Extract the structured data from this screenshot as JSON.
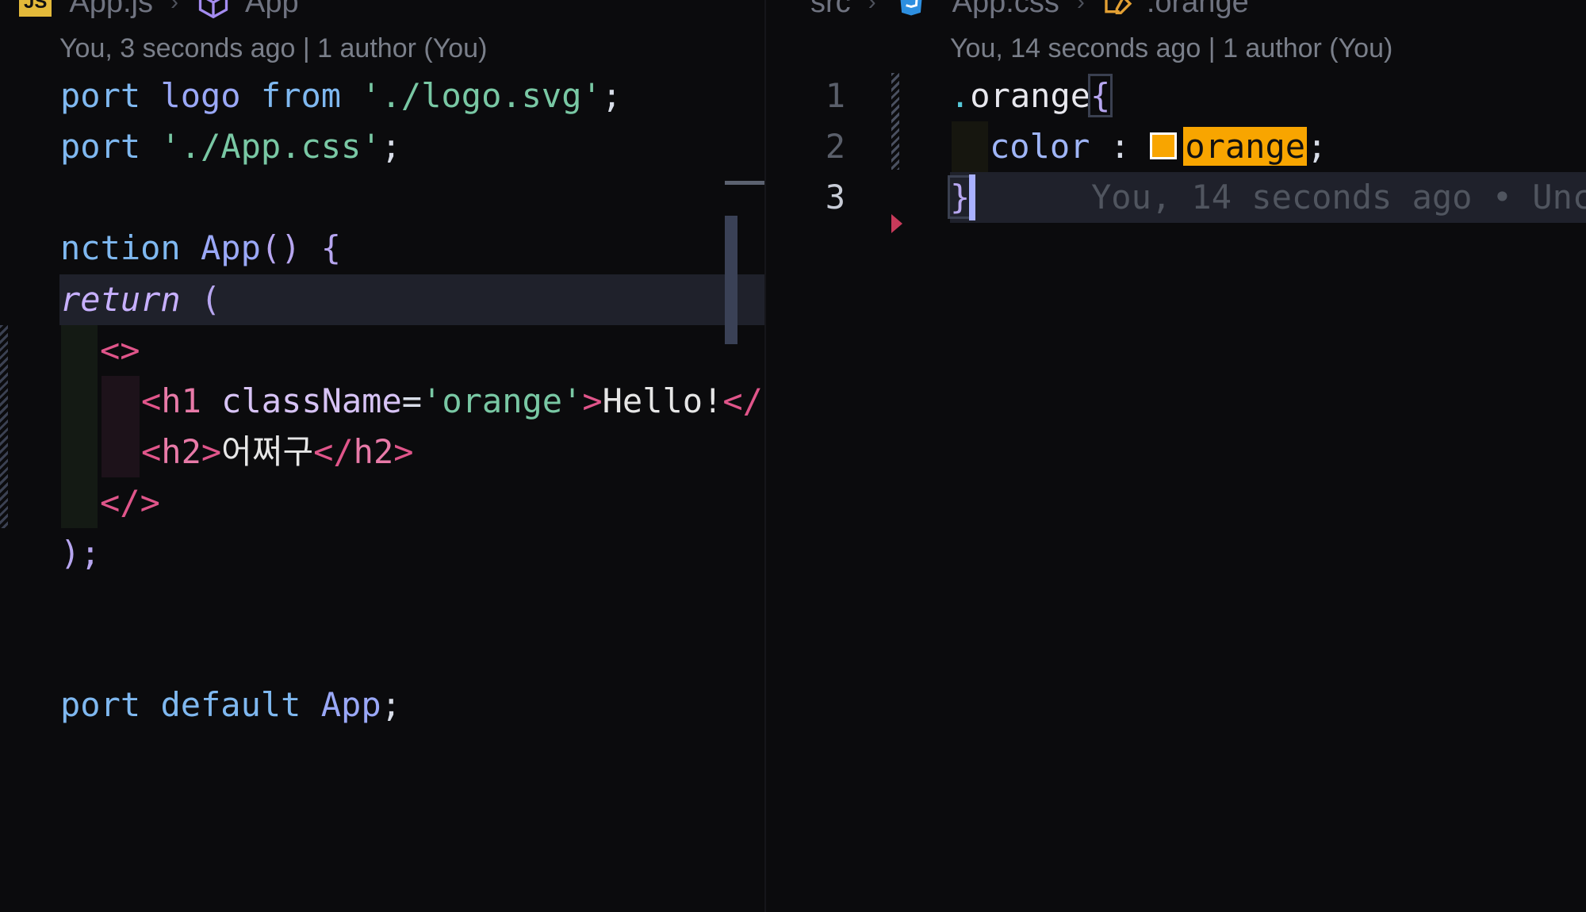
{
  "colors": {
    "background": "#0b0b0d",
    "current_line": "#1f212b",
    "css_orange": "#f8a500"
  },
  "left_editor": {
    "breadcrumb": {
      "file_icon": "js-badge",
      "file_icon_label": "JS",
      "file": "App.js",
      "symbol_icon": "cube-icon",
      "symbol": "App"
    },
    "codelens": "You, 3 seconds ago | 1 author (You)",
    "code": {
      "l1": {
        "kw": "port",
        "id": "logo",
        "from": "from",
        "str": "'./logo.svg'",
        "end": ";"
      },
      "l2": {
        "kw": "port",
        "str": "'./App.css'",
        "end": ";"
      },
      "l4": {
        "kw": "nction",
        "name": "App",
        "parens": "()",
        "brace": "{"
      },
      "l5": {
        "ret": "return",
        "paren": "("
      },
      "l6": {
        "frag_open": "<>"
      },
      "l7": {
        "open": "<",
        "tag": "h1",
        "attr": "className",
        "eq": "=",
        "val": "'orange'",
        "gt": ">",
        "text": "Hello!",
        "close": "</"
      },
      "l8": {
        "open": "<",
        "tag": "h2",
        "gt": ">",
        "text": "어쩌구",
        "close_open": "</",
        "close_tag": "h2",
        "close_gt": ">"
      },
      "l9": {
        "frag_close": "</>"
      },
      "l10": {
        "text": ");"
      },
      "l13": {
        "kw": "port",
        "def": "default",
        "name": "App",
        "end": ";"
      }
    }
  },
  "right_editor": {
    "breadcrumb": {
      "folder": "src",
      "file_icon": "css-icon",
      "file": "App.css",
      "symbol_icon": "selector-icon",
      "symbol": ".orange"
    },
    "codelens": "You, 14 seconds ago | 1 author (You)",
    "line_numbers": [
      "1",
      "2",
      "3"
    ],
    "code": {
      "l1": {
        "dot": ".",
        "selector": "orange",
        "brace": "{"
      },
      "l2": {
        "prop": "color",
        "colon": ":",
        "value": "orange",
        "end": ";"
      },
      "l3": {
        "brace": "}"
      }
    },
    "blame": "You, 14 seconds ago • Unc"
  }
}
